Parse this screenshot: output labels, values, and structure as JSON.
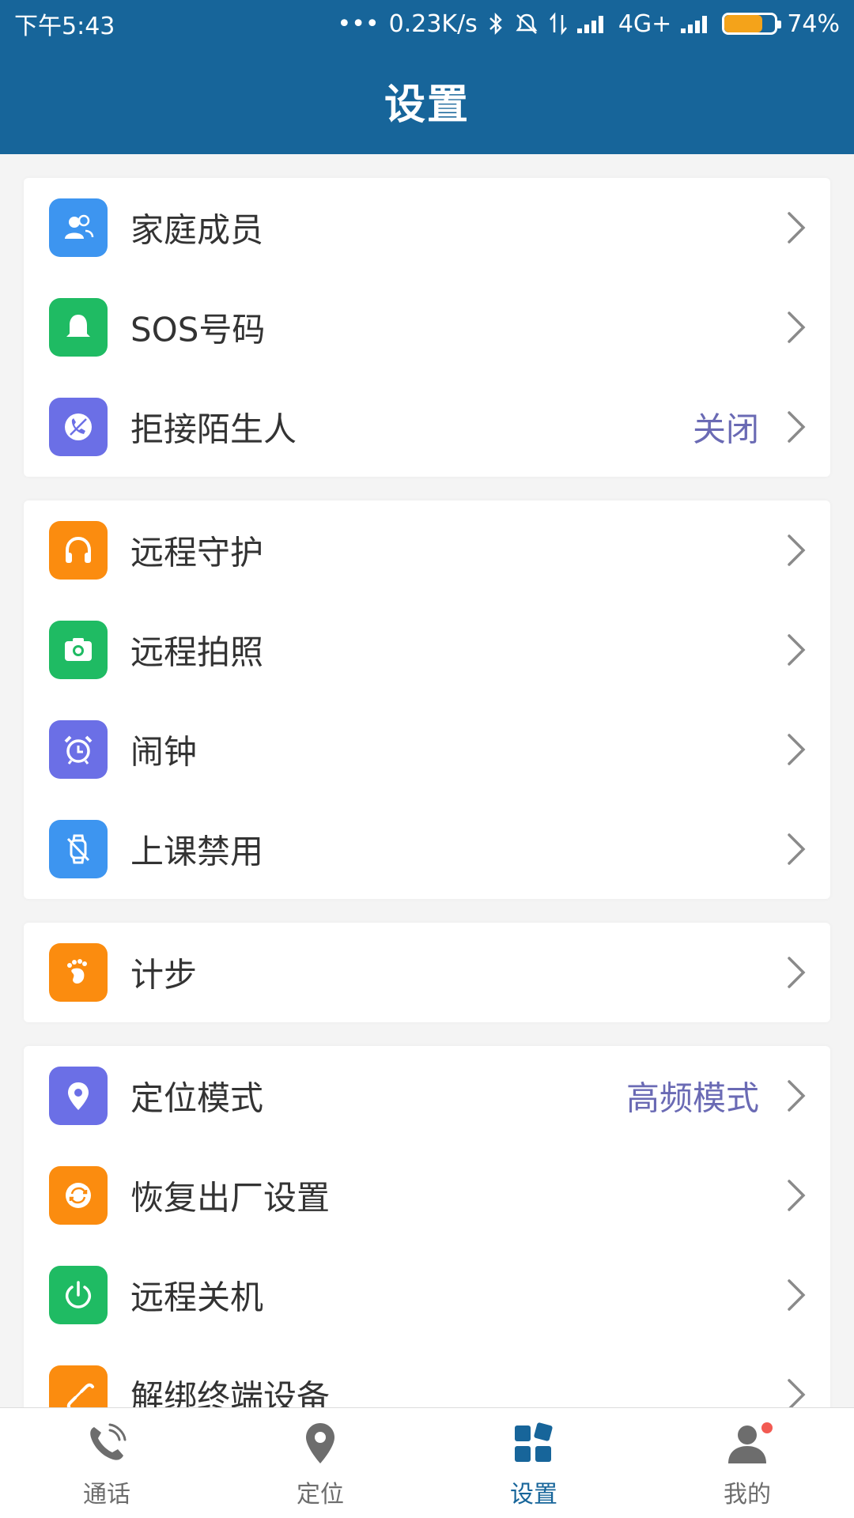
{
  "statusbar": {
    "time": "下午5:43",
    "dots": "•••",
    "speed": "0.23K/s",
    "network": "4G+",
    "battery": "74%",
    "battery_level": 0.74
  },
  "header": {
    "title": "设置"
  },
  "groups": [
    {
      "items": [
        {
          "label": "家庭成员",
          "icon": "family-members-icon",
          "color": "#3d95f0",
          "value": ""
        },
        {
          "label": "SOS号码",
          "icon": "sos-bell-icon",
          "color": "#1fbb63",
          "value": ""
        },
        {
          "label": "拒接陌生人",
          "icon": "block-call-icon",
          "color": "#6b6fe6",
          "value": "关闭"
        }
      ]
    },
    {
      "items": [
        {
          "label": "远程守护",
          "icon": "headphones-icon",
          "color": "#fb8c0f",
          "value": ""
        },
        {
          "label": "远程拍照",
          "icon": "camera-icon",
          "color": "#1fbb63",
          "value": ""
        },
        {
          "label": "闹钟",
          "icon": "alarm-clock-icon",
          "color": "#6b6fe6",
          "value": ""
        },
        {
          "label": "上课禁用",
          "icon": "watch-disabled-icon",
          "color": "#3d95f0",
          "value": ""
        }
      ]
    },
    {
      "items": [
        {
          "label": "计步",
          "icon": "footprint-icon",
          "color": "#fb8c0f",
          "value": ""
        }
      ]
    },
    {
      "items": [
        {
          "label": "定位模式",
          "icon": "location-pin-icon",
          "color": "#6b6fe6",
          "value": "高频模式"
        },
        {
          "label": "恢复出厂设置",
          "icon": "factory-reset-icon",
          "color": "#fb8c0f",
          "value": ""
        },
        {
          "label": "远程关机",
          "icon": "power-icon",
          "color": "#1fbb63",
          "value": ""
        },
        {
          "label": "解绑终端设备",
          "icon": "unlink-icon",
          "color": "#fb8c0f",
          "value": ""
        }
      ]
    }
  ],
  "bottom_nav": [
    {
      "label": "通话",
      "icon": "phone-icon",
      "active": false
    },
    {
      "label": "定位",
      "icon": "location-icon",
      "active": false
    },
    {
      "label": "设置",
      "icon": "settings-tiles-icon",
      "active": true
    },
    {
      "label": "我的",
      "icon": "profile-icon",
      "active": false,
      "badge": true
    }
  ],
  "colors": {
    "primary": "#17659a",
    "value_text": "#6a6ab4",
    "badge": "#f25a52"
  }
}
